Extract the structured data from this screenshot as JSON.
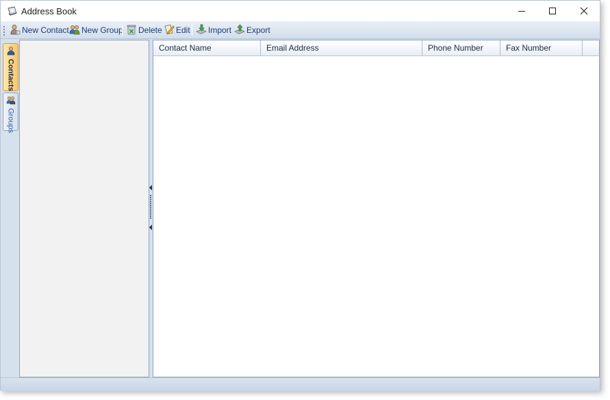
{
  "window": {
    "title": "Address Book",
    "icon": "address-book-icon",
    "controls": {
      "minimize": "minimize-icon",
      "maximize": "maximize-icon",
      "close": "close-icon"
    }
  },
  "toolbar": {
    "items": [
      {
        "label": "New Contact",
        "icon": "new-contact-icon"
      },
      {
        "label": "New Group",
        "icon": "new-group-icon"
      },
      {
        "label": "Delete",
        "icon": "delete-icon"
      },
      {
        "label": "Edit",
        "icon": "edit-icon"
      },
      {
        "label": "Import",
        "icon": "import-icon"
      },
      {
        "label": "Export",
        "icon": "export-icon"
      }
    ]
  },
  "sidebar": {
    "tabs": [
      {
        "label": "Contacts",
        "icon": "contacts-icon",
        "active": true
      },
      {
        "label": "Groups",
        "icon": "groups-icon",
        "active": false
      }
    ]
  },
  "grid": {
    "columns": [
      "Contact Name",
      "Email Address",
      "Phone Number",
      "Fax Number"
    ],
    "rows": []
  },
  "colors": {
    "toolbar_bg": "#d2deec",
    "panel_bg": "#d6e1ee",
    "active_tab": "#f9c86a",
    "label_text": "#1c3d6e"
  }
}
